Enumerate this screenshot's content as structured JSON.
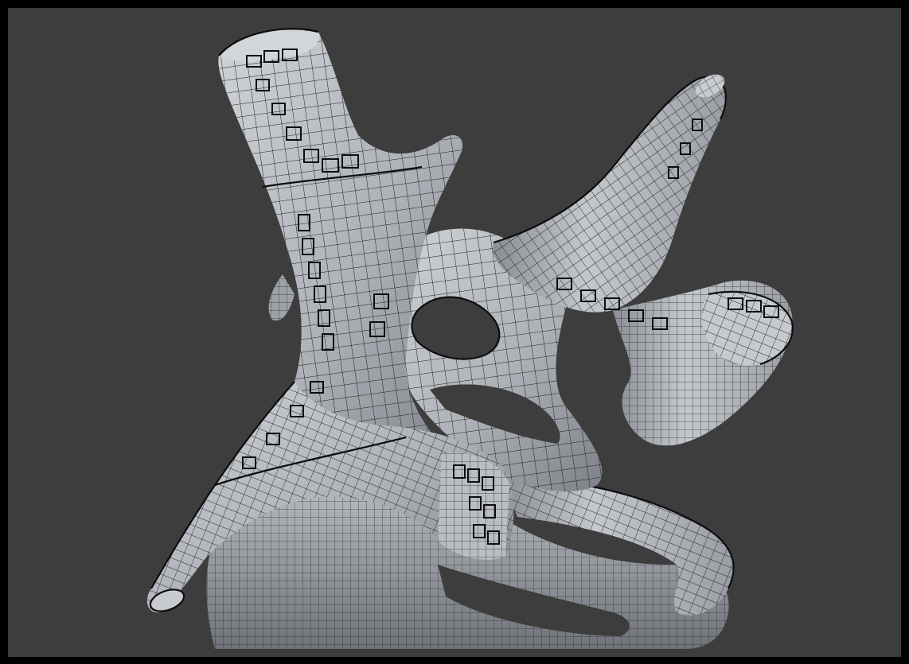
{
  "viewport": {
    "background_color": "#3d3d3d",
    "frame_color": "#000000",
    "mesh_base_color": "#b5b9bf",
    "mesh_shadow_color": "#8c9096",
    "wireframe_color": "#1a1a1a"
  },
  "scene": {
    "object": "branching-organic-mesh",
    "display_mode": "solid-with-wireframe",
    "icons": []
  }
}
